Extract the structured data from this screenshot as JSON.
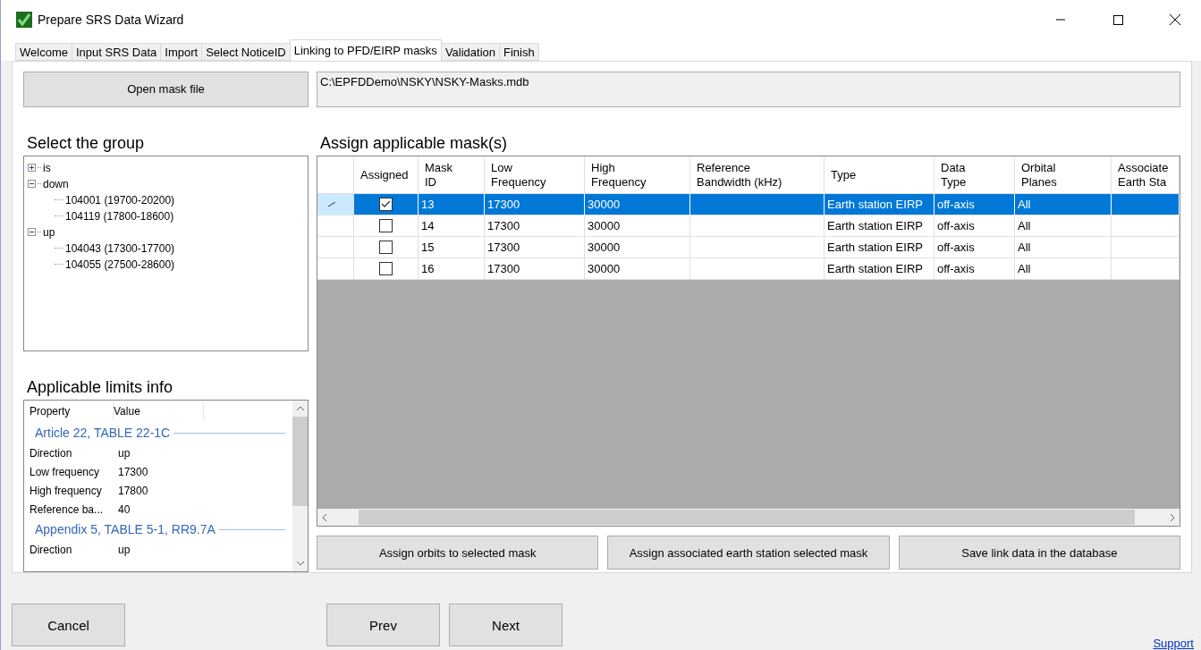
{
  "window": {
    "title": "Prepare SRS Data Wizard"
  },
  "tabs": [
    {
      "label": "Welcome",
      "selected": false
    },
    {
      "label": "Input SRS Data",
      "selected": false
    },
    {
      "label": "Import",
      "selected": false
    },
    {
      "label": "Select NoticeID",
      "selected": false
    },
    {
      "label": "Linking to PFD/EIRP masks",
      "selected": true
    },
    {
      "label": "Validation",
      "selected": false
    },
    {
      "label": "Finish",
      "selected": false
    }
  ],
  "open_button": "Open mask file",
  "mask_path": "C:\\EPFDDemo\\NSKY\\NSKY-Masks.mdb",
  "group_tree": {
    "title": "Select the group",
    "items": [
      {
        "label": "is",
        "expanded": false
      },
      {
        "label": "down",
        "expanded": true,
        "children": [
          {
            "label": "104001 (19700-20200)"
          },
          {
            "label": "104119 (17800-18600)"
          }
        ]
      },
      {
        "label": "up",
        "expanded": true,
        "children": [
          {
            "label": "104043 (17300-17700)"
          },
          {
            "label": "104055 (27500-28600)"
          }
        ]
      }
    ]
  },
  "limits": {
    "title": "Applicable limits info",
    "columns": [
      "Property",
      "Value"
    ],
    "groups": [
      {
        "title": "Article 22, TABLE 22-1C",
        "rows": [
          [
            "Direction",
            "up"
          ],
          [
            "Low frequency",
            "17300"
          ],
          [
            "High frequency",
            "17800"
          ],
          [
            "Reference ba...",
            "40"
          ]
        ]
      },
      {
        "title": "Appendix 5, TABLE 5-1, RR9.7A",
        "rows": [
          [
            "Direction",
            "up"
          ]
        ]
      }
    ]
  },
  "masks": {
    "title": "Assign applicable mask(s)",
    "columns": [
      "Assigned",
      "Mask\nID",
      "Low\nFrequency",
      "High\nFrequency",
      "Reference\nBandwidth (kHz)",
      "Type",
      "Data\nType",
      "Orbital\nPlanes",
      "Associate\nEarth Sta"
    ],
    "rows": [
      {
        "selected": true,
        "editing": true,
        "assigned": true,
        "cells": [
          "",
          "13",
          "17300",
          "30000",
          "",
          "Earth station EIRP",
          "off-axis",
          "All",
          ""
        ]
      },
      {
        "selected": false,
        "editing": false,
        "assigned": false,
        "cells": [
          "",
          "14",
          "17300",
          "30000",
          "",
          "Earth station EIRP",
          "off-axis",
          "All",
          ""
        ]
      },
      {
        "selected": false,
        "editing": false,
        "assigned": false,
        "cells": [
          "",
          "15",
          "17300",
          "30000",
          "",
          "Earth station EIRP",
          "off-axis",
          "All",
          ""
        ]
      },
      {
        "selected": false,
        "editing": false,
        "assigned": false,
        "cells": [
          "",
          "16",
          "17300",
          "30000",
          "",
          "Earth station EIRP",
          "off-axis",
          "All",
          ""
        ]
      }
    ]
  },
  "action_buttons": [
    "Assign orbits to selected mask",
    "Assign associated earth station selected mask",
    "Save link data in the database"
  ],
  "nav_buttons": {
    "cancel": "Cancel",
    "prev": "Prev",
    "next": "Next"
  },
  "support_link": "Support"
}
